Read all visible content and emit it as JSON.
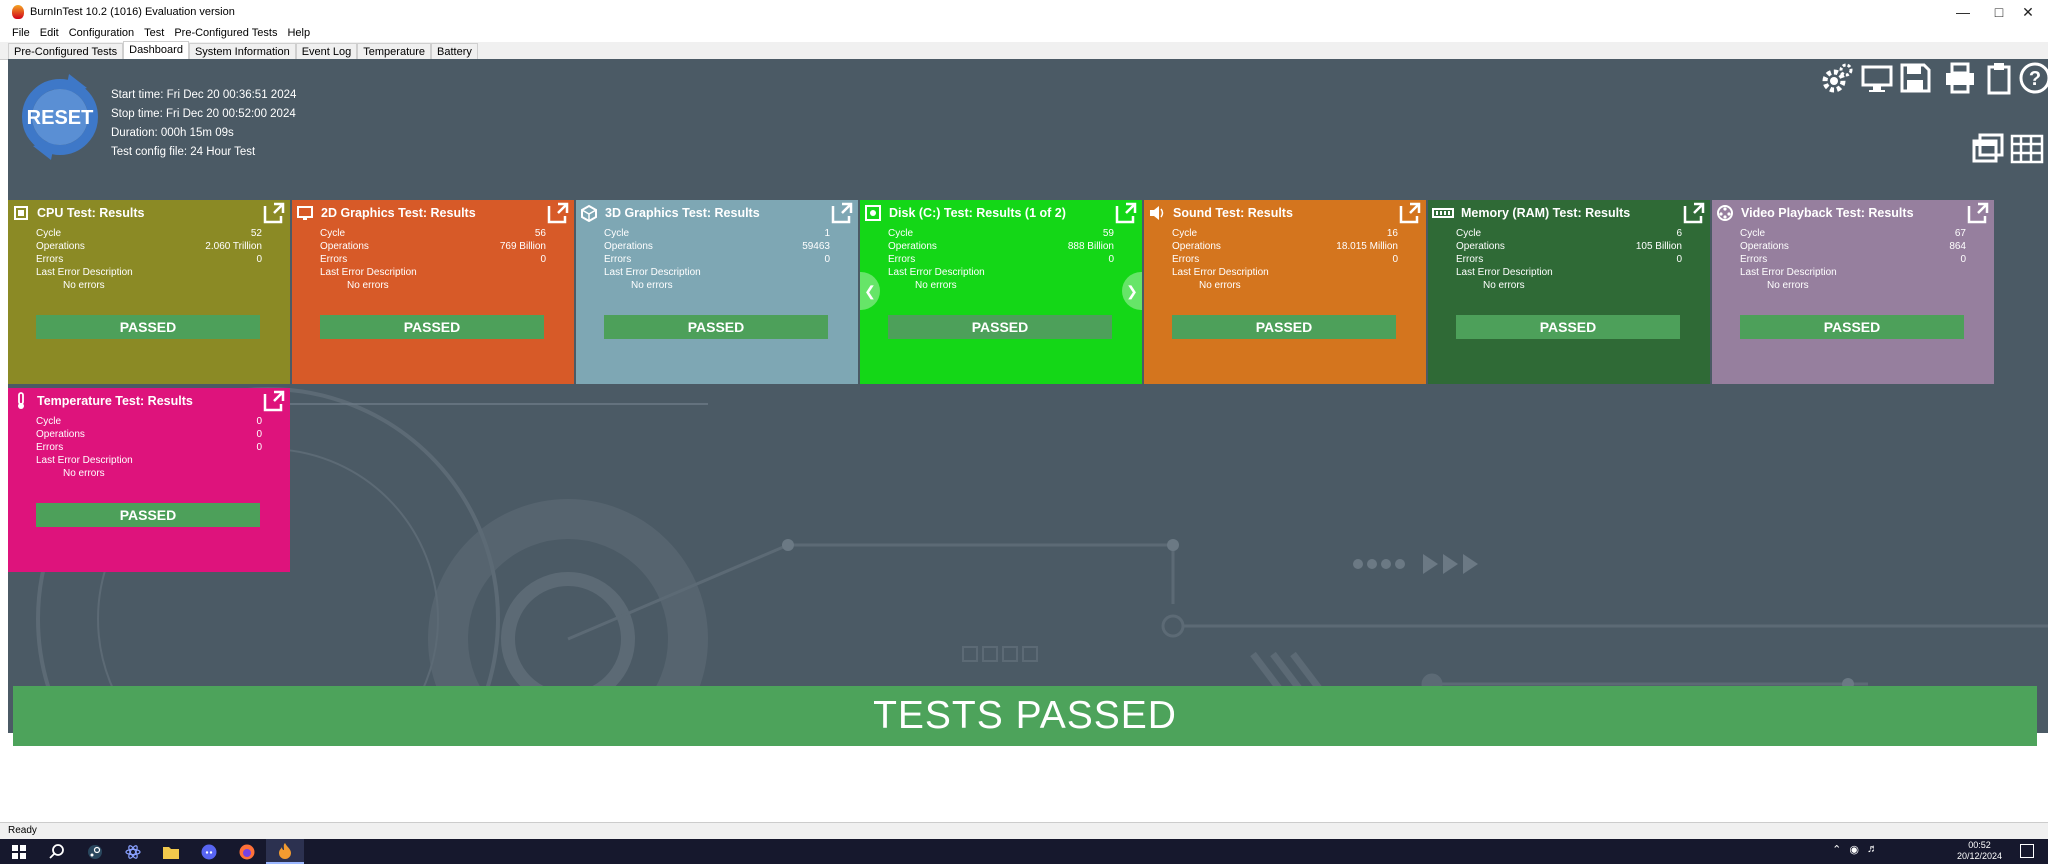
{
  "window": {
    "title": "BurnInTest 10.2 (1016) Evaluation version"
  },
  "menu": [
    "File",
    "Edit",
    "Configuration",
    "Test",
    "Pre-Configured Tests",
    "Help"
  ],
  "tabs": [
    "Pre-Configured Tests",
    "Dashboard",
    "System Information",
    "Event Log",
    "Temperature",
    "Battery"
  ],
  "active_tab": "Dashboard",
  "info": {
    "start": "Start time: Fri Dec 20 00:36:51 2024",
    "stop": "Stop time: Fri Dec 20 00:52:00 2024",
    "duration": "Duration: 000h 15m 09s",
    "config": "Test config file: 24 Hour Test"
  },
  "reset_label": "RESET",
  "row_labels": {
    "cycle": "Cycle",
    "operations": "Operations",
    "errors": "Errors",
    "last_error": "Last Error Description"
  },
  "cards": [
    {
      "title": "CPU Test: Results",
      "icon": "cpu-icon",
      "color": "#8b8a25",
      "cycle": "52",
      "operations": "2.060 Trillion",
      "errors": "0",
      "last_error": "No errors",
      "status": "PASSED"
    },
    {
      "title": "2D Graphics Test: Results",
      "icon": "monitor-icon",
      "color": "#d75a28",
      "cycle": "56",
      "operations": "769 Billion",
      "errors": "0",
      "last_error": "No errors",
      "status": "PASSED"
    },
    {
      "title": "3D Graphics Test: Results",
      "icon": "3d-graphics-icon",
      "color": "#7ea7b4",
      "cycle": "1",
      "operations": "59463",
      "errors": "0",
      "last_error": "No errors",
      "status": "PASSED"
    },
    {
      "title": "Disk (C:) Test: Results (1 of 2)",
      "icon": "disk-icon",
      "color": "#14d717",
      "cycle": "59",
      "operations": "888 Billion",
      "errors": "0",
      "last_error": "No errors",
      "status": "PASSED"
    },
    {
      "title": "Sound Test: Results",
      "icon": "speaker-icon",
      "color": "#d4751e",
      "cycle": "16",
      "operations": "18.015 Million",
      "errors": "0",
      "last_error": "No errors",
      "status": "PASSED"
    },
    {
      "title": "Memory (RAM) Test: Results",
      "icon": "memory-icon",
      "color": "#2f6a36",
      "cycle": "6",
      "operations": "105 Billion",
      "errors": "0",
      "last_error": "No errors",
      "status": "PASSED"
    },
    {
      "title": "Video Playback Test: Results",
      "icon": "film-reel-icon",
      "color": "#967f9e",
      "cycle": "67",
      "operations": "864",
      "errors": "0",
      "last_error": "No errors",
      "status": "PASSED"
    },
    {
      "title": "Temperature Test: Results",
      "icon": "thermometer-icon",
      "color": "#de137c",
      "cycle": "0",
      "operations": "0",
      "errors": "0",
      "last_error": "No errors",
      "status": "PASSED"
    }
  ],
  "banner": "TESTS PASSED",
  "status": "Ready",
  "clock": {
    "time": "00:52",
    "date": "20/12/2024"
  }
}
